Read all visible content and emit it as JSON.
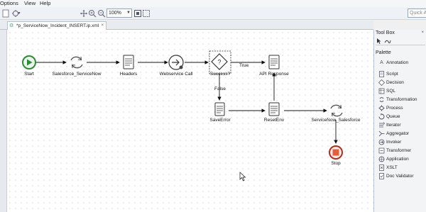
{
  "menu": {
    "items": [
      "Options",
      "View",
      "Help"
    ]
  },
  "toolbar": {
    "zoom_value": "100%",
    "quick_access": "Quick A"
  },
  "editor": {
    "tab_label": "*p_ServiceNow_Incident_INSERT.ip.xml",
    "close_glyph": "×"
  },
  "diagram": {
    "nodes": [
      {
        "id": "start",
        "label": "Start",
        "icon": "start-circle-icon"
      },
      {
        "id": "salesforce_servicenow",
        "label": "Salesforce_ServiceNow",
        "icon": "cycle-icon"
      },
      {
        "id": "headers",
        "label": "Headers",
        "icon": "script-scroll-icon"
      },
      {
        "id": "webservice_call",
        "label": "Webservice Call",
        "icon": "invoke-arrow-icon"
      },
      {
        "id": "success",
        "label": "Success?",
        "icon": "decision-diamond-icon"
      },
      {
        "id": "api_response",
        "label": "API Response",
        "icon": "script-scroll-icon"
      },
      {
        "id": "saveerror",
        "label": "SaveError",
        "icon": "script-scroll-icon"
      },
      {
        "id": "resetenv",
        "label": "ResetEnv",
        "icon": "script-scroll-icon"
      },
      {
        "id": "servicenow_salesforce",
        "label": "ServiceNow_Salesforce",
        "icon": "cycle-icon"
      },
      {
        "id": "stop",
        "label": "Stop",
        "icon": "stop-circle-icon"
      }
    ],
    "edge_labels": {
      "true_label": "True",
      "false_label": "False"
    }
  },
  "toolbox": {
    "title": "Tool Box",
    "close_glyph": "×",
    "palette_title": "Palette",
    "palette_items": [
      {
        "label": "Annotation",
        "icon": "annotation-icon"
      },
      {
        "label": "Script",
        "icon": "script-icon"
      },
      {
        "label": "Decision",
        "icon": "decision-icon"
      },
      {
        "label": "SQL",
        "icon": "sql-icon"
      },
      {
        "label": "Transformation",
        "icon": "transformation-icon"
      },
      {
        "label": "Process",
        "icon": "process-icon"
      },
      {
        "label": "Queue",
        "icon": "queue-icon"
      },
      {
        "label": "Iterator",
        "icon": "iterator-icon"
      },
      {
        "label": "Aggregator",
        "icon": "aggregator-icon"
      },
      {
        "label": "Invoker",
        "icon": "invoker-icon"
      },
      {
        "label": "Transformer",
        "icon": "transformer-icon"
      },
      {
        "label": "Application",
        "icon": "application-icon"
      },
      {
        "label": "XSLT",
        "icon": "xslt-icon"
      },
      {
        "label": "Doc Validator",
        "icon": "doc-validator-icon"
      }
    ]
  }
}
